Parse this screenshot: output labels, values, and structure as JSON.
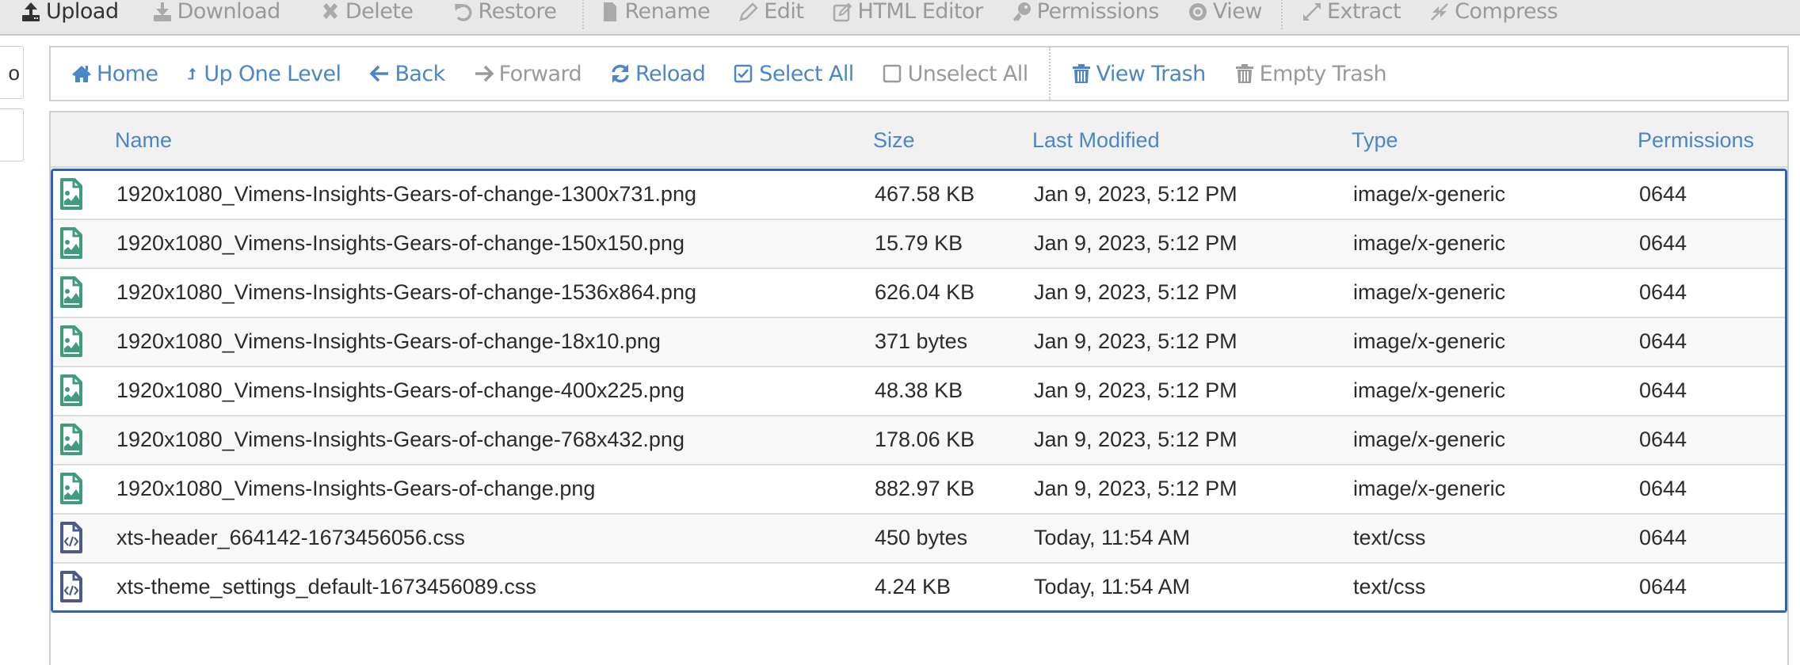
{
  "toolbar": {
    "items": [
      {
        "label": "Upload",
        "icon": "upload-icon",
        "enabled": true
      },
      {
        "label": "Download",
        "icon": "download-icon",
        "enabled": false
      },
      {
        "label": "Delete",
        "icon": "delete-icon",
        "enabled": false
      },
      {
        "label": "Restore",
        "icon": "restore-icon",
        "enabled": false
      },
      {
        "label": "Rename",
        "icon": "file-icon",
        "enabled": false
      },
      {
        "label": "Edit",
        "icon": "pencil-icon",
        "enabled": false
      },
      {
        "label": "HTML Editor",
        "icon": "edit-square-icon",
        "enabled": false
      },
      {
        "label": "Permissions",
        "icon": "key-icon",
        "enabled": false
      },
      {
        "label": "View",
        "icon": "eye-icon",
        "enabled": false
      },
      {
        "label": "Extract",
        "icon": "expand-icon",
        "enabled": false
      },
      {
        "label": "Compress",
        "icon": "compress-icon",
        "enabled": false
      }
    ]
  },
  "sidebar": {
    "partial_text": "o"
  },
  "navbar": {
    "items": [
      {
        "label": "Home",
        "icon": "home-icon",
        "enabled": true
      },
      {
        "label": "Up One Level",
        "icon": "level-up-icon",
        "enabled": true
      },
      {
        "label": "Back",
        "icon": "arrow-left-icon",
        "enabled": true
      },
      {
        "label": "Forward",
        "icon": "arrow-right-icon",
        "enabled": false
      },
      {
        "label": "Reload",
        "icon": "refresh-icon",
        "enabled": true
      },
      {
        "label": "Select All",
        "icon": "checkbox-checked-icon",
        "enabled": true
      },
      {
        "label": "Unselect All",
        "icon": "checkbox-empty-icon",
        "enabled": false
      },
      {
        "label": "View Trash",
        "icon": "trash-icon",
        "enabled": true
      },
      {
        "label": "Empty Trash",
        "icon": "trash-icon",
        "enabled": false
      }
    ]
  },
  "table": {
    "columns": [
      "Name",
      "Size",
      "Last Modified",
      "Type",
      "Permissions"
    ],
    "rows": [
      {
        "name": "1920x1080_Vimens-Insights-Gears-of-change-1300x731.png",
        "size": "467.58 KB",
        "modified": "Jan 9, 2023, 5:12 PM",
        "type": "image/x-generic",
        "perms": "0644",
        "icon": "image-file-icon"
      },
      {
        "name": "1920x1080_Vimens-Insights-Gears-of-change-150x150.png",
        "size": "15.79 KB",
        "modified": "Jan 9, 2023, 5:12 PM",
        "type": "image/x-generic",
        "perms": "0644",
        "icon": "image-file-icon"
      },
      {
        "name": "1920x1080_Vimens-Insights-Gears-of-change-1536x864.png",
        "size": "626.04 KB",
        "modified": "Jan 9, 2023, 5:12 PM",
        "type": "image/x-generic",
        "perms": "0644",
        "icon": "image-file-icon"
      },
      {
        "name": "1920x1080_Vimens-Insights-Gears-of-change-18x10.png",
        "size": "371 bytes",
        "modified": "Jan 9, 2023, 5:12 PM",
        "type": "image/x-generic",
        "perms": "0644",
        "icon": "image-file-icon"
      },
      {
        "name": "1920x1080_Vimens-Insights-Gears-of-change-400x225.png",
        "size": "48.38 KB",
        "modified": "Jan 9, 2023, 5:12 PM",
        "type": "image/x-generic",
        "perms": "0644",
        "icon": "image-file-icon"
      },
      {
        "name": "1920x1080_Vimens-Insights-Gears-of-change-768x432.png",
        "size": "178.06 KB",
        "modified": "Jan 9, 2023, 5:12 PM",
        "type": "image/x-generic",
        "perms": "0644",
        "icon": "image-file-icon"
      },
      {
        "name": "1920x1080_Vimens-Insights-Gears-of-change.png",
        "size": "882.97 KB",
        "modified": "Jan 9, 2023, 5:12 PM",
        "type": "image/x-generic",
        "perms": "0644",
        "icon": "image-file-icon"
      },
      {
        "name": "xts-header_664142-1673456056.css",
        "size": "450 bytes",
        "modified": "Today, 11:54 AM",
        "type": "text/css",
        "perms": "0644",
        "icon": "code-file-icon"
      },
      {
        "name": "xts-theme_settings_default-1673456089.css",
        "size": "4.24 KB",
        "modified": "Today, 11:54 AM",
        "type": "text/css",
        "perms": "0644",
        "icon": "code-file-icon"
      }
    ]
  },
  "colors": {
    "link": "#4a86c8",
    "disabled": "#9a9a9a",
    "selection_border": "#2a62c2",
    "image_icon": "#3f9c7d",
    "code_icon": "#4d5a85"
  }
}
